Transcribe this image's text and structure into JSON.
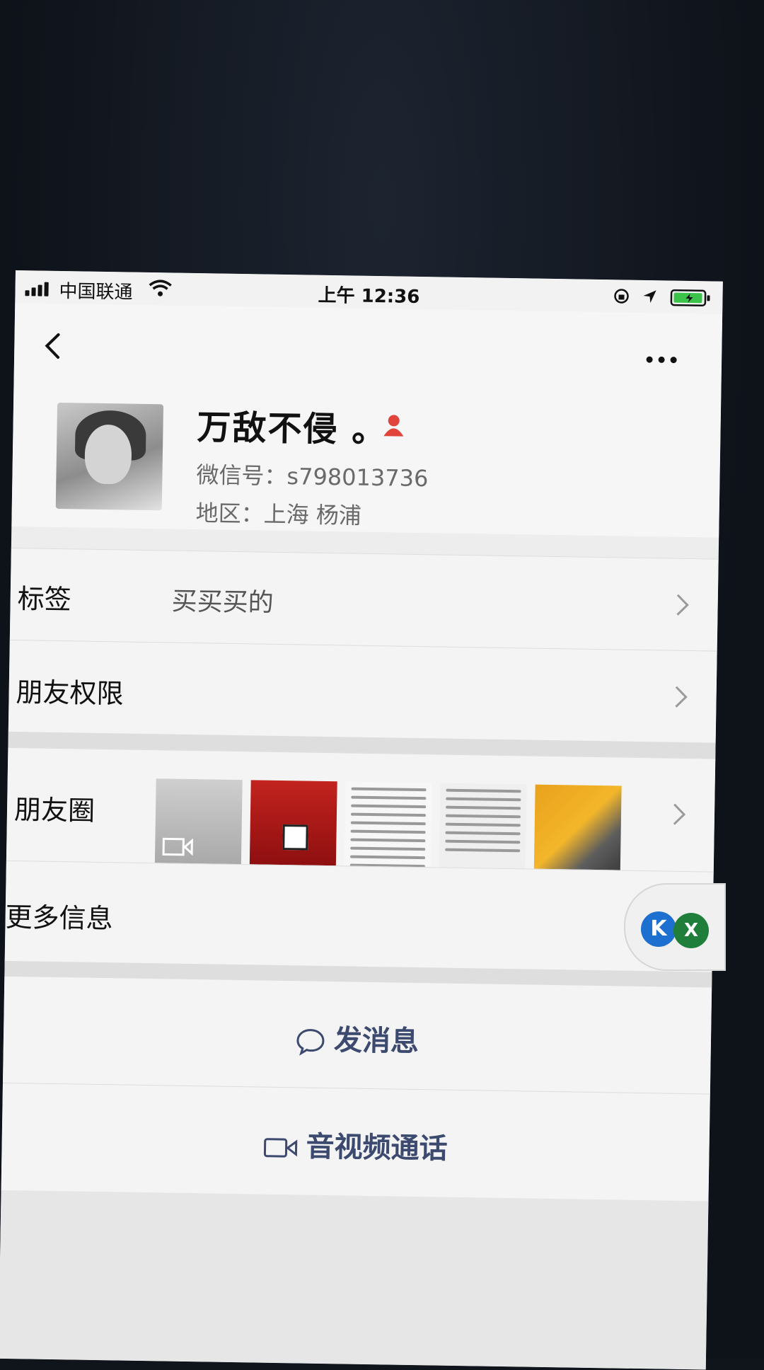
{
  "status_bar": {
    "carrier": "中国联通",
    "time": "上午 12:36"
  },
  "profile": {
    "nickname": "万敌不侵 。",
    "wechat_id": "微信号：s798013736",
    "region": "地区：上海 杨浦"
  },
  "rows": {
    "tags_label": "标签",
    "tags_value": "买买买的",
    "permissions_label": "朋友权限",
    "moments_label": "朋友圈",
    "more_info_label": "更多信息"
  },
  "actions": {
    "message": "发消息",
    "call": "音视频通话"
  },
  "floating": {
    "k_badge": "K",
    "x_badge": "X"
  },
  "colors": {
    "accent_text": "#3b4a6e",
    "gender_icon": "#e0443a",
    "k_badge": "#1d6fd0",
    "x_badge": "#1f7f3a"
  },
  "icons": [
    "signal-icon",
    "wifi-icon",
    "lock-icon",
    "location-icon",
    "battery-icon",
    "back-icon",
    "more-icon",
    "gender-icon",
    "chevron-icon",
    "chat-bubble-icon",
    "video-camera-icon"
  ]
}
